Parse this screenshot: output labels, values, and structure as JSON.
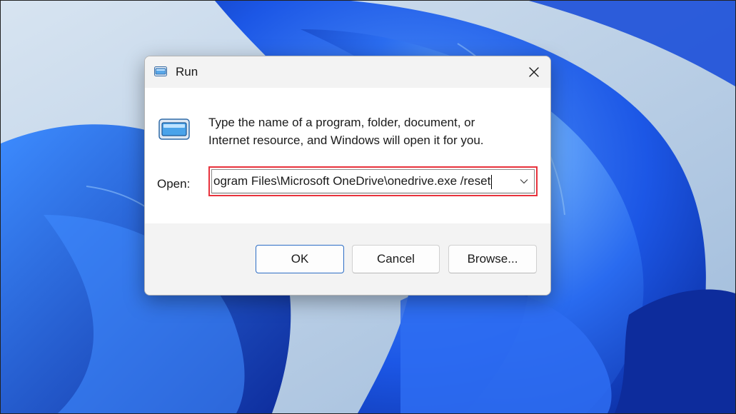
{
  "dialog": {
    "title": "Run",
    "description_line1": "Type the name of a program, folder, document, or",
    "description_line2": "Internet resource, and Windows will open it for you.",
    "open_label": "Open:",
    "open_value": "ogram Files\\Microsoft OneDrive\\onedrive.exe /reset",
    "buttons": {
      "ok": "OK",
      "cancel": "Cancel",
      "browse": "Browse..."
    }
  },
  "icons": {
    "title": "run-icon",
    "body": "run-icon",
    "close": "close-icon",
    "dropdown": "chevron-down-icon"
  },
  "colors": {
    "highlight_border": "#e8323c",
    "wallpaper_primary": "#1e5ae0",
    "wallpaper_background": "#b9cde3"
  }
}
